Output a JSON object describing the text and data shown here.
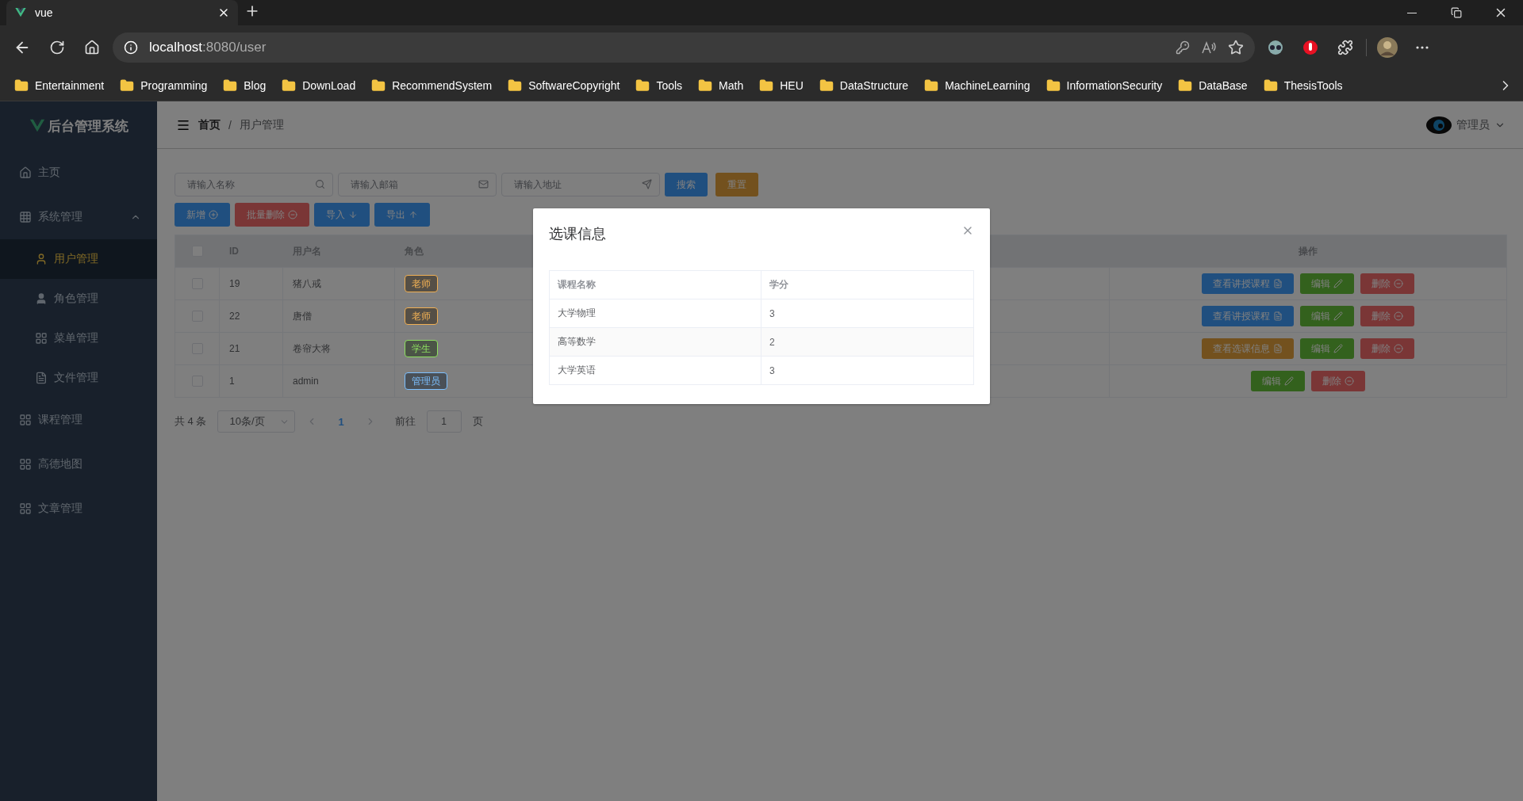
{
  "browser": {
    "tab_title": "vue",
    "url_host": "localhost",
    "url_rest": ":8080/user",
    "bookmarks": [
      "Entertainment",
      "Programming",
      "Blog",
      "DownLoad",
      "RecommendSystem",
      "SoftwareCopyright",
      "Tools",
      "Math",
      "HEU",
      "DataStructure",
      "MachineLearning",
      "InformationSecurity",
      "DataBase",
      "ThesisTools"
    ]
  },
  "app": {
    "logo": "后台管理系统",
    "sidebar": [
      {
        "label": "主页",
        "selected": false
      },
      {
        "label": "系统管理",
        "selected": false,
        "expanded": true,
        "children": [
          {
            "label": "用户管理",
            "selected": true
          },
          {
            "label": "角色管理",
            "selected": false
          },
          {
            "label": "菜单管理",
            "selected": false
          },
          {
            "label": "文件管理",
            "selected": false
          }
        ]
      },
      {
        "label": "课程管理",
        "selected": false
      },
      {
        "label": "高德地图",
        "selected": false
      },
      {
        "label": "文章管理",
        "selected": false
      }
    ],
    "breadcrumb": [
      "首页",
      "用户管理"
    ],
    "breadcrumb_separator": "/",
    "user": "管理员",
    "search": [
      {
        "placeholder": "请输入名称"
      },
      {
        "placeholder": "请输入邮箱"
      },
      {
        "placeholder": "请输入地址"
      }
    ],
    "search_buttons": [
      {
        "label": "搜索",
        "kind": "primary"
      },
      {
        "label": "重置",
        "kind": "warning"
      }
    ],
    "toolbar": [
      {
        "label": "新增",
        "kind": "add"
      },
      {
        "label": "批量删除",
        "kind": "delete"
      },
      {
        "label": "导入",
        "kind": "import"
      },
      {
        "label": "导出",
        "kind": "export"
      }
    ],
    "table": {
      "select_all_checked": false,
      "columns": [
        "ID",
        "用户名",
        "角色",
        "操作"
      ],
      "rows": [
        {
          "checked": false,
          "id": "19",
          "username": "猪八戒",
          "role": "老师",
          "color": "#f0b055",
          "actions": [
            {
              "label": "查看讲授课程",
              "kind": "primary"
            },
            {
              "label": "编辑",
              "kind": "success"
            },
            {
              "label": "删除",
              "kind": "danger"
            }
          ]
        },
        {
          "checked": false,
          "id": "22",
          "username": "唐僧",
          "role": "老师",
          "color": "#f0b055",
          "actions": [
            {
              "label": "查看讲授课程",
              "kind": "primary"
            },
            {
              "label": "编辑",
              "kind": "success"
            },
            {
              "label": "删除",
              "kind": "danger"
            }
          ]
        },
        {
          "checked": false,
          "id": "21",
          "username": "卷帘大将",
          "role": "学生",
          "color": "#8ee060",
          "actions": [
            {
              "label": "查看选课信息",
              "kind": "warning"
            },
            {
              "label": "编辑",
              "kind": "success"
            },
            {
              "label": "删除",
              "kind": "danger"
            }
          ]
        },
        {
          "checked": false,
          "id": "1",
          "username": "admin",
          "role": "管理员",
          "color": "#7cc0ff",
          "actions": [
            {
              "label": "编辑",
              "kind": "success"
            },
            {
              "label": "删除",
              "kind": "danger"
            }
          ]
        }
      ]
    },
    "pagination": {
      "total": "共 4 条",
      "page_size": "10条/页",
      "pages": [
        {
          "label": "1",
          "selected": true
        }
      ],
      "goto": "前往",
      "goto_value": "1",
      "unit": "页"
    },
    "dialog": {
      "title": "选课信息",
      "columns": [
        "课程名称",
        "学分"
      ],
      "rows": [
        [
          "大学物理",
          "3"
        ],
        [
          "高等数学",
          "2"
        ],
        [
          "大学英语",
          "3"
        ]
      ]
    }
  }
}
